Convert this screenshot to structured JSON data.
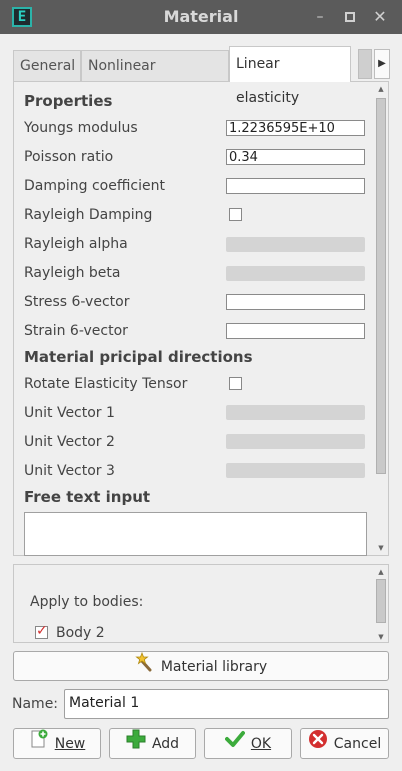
{
  "window": {
    "title": "Material",
    "app_icon_letter": "E",
    "minimize_glyph": "–",
    "maximize_glyph": "▫",
    "close_glyph": "✕"
  },
  "tabs": [
    {
      "label": "General",
      "active": false
    },
    {
      "label": "Nonlinear elasticity",
      "active": false
    },
    {
      "label": "Linear elasticity",
      "active": true
    }
  ],
  "properties": {
    "section_title": "Properties",
    "youngs_label": "Youngs modulus",
    "youngs_value": "1.2236595E+10",
    "poisson_label": "Poisson ratio",
    "poisson_value": "0.34",
    "damping_label": "Damping coefficient",
    "damping_value": "",
    "rayleigh_damping_label": "Rayleigh Damping",
    "rayleigh_damping_checked": false,
    "rayleigh_alpha_label": "Rayleigh alpha",
    "rayleigh_beta_label": "Rayleigh beta",
    "stress_label": "Stress 6-vector",
    "stress_value": "",
    "strain_label": "Strain 6-vector",
    "strain_value": ""
  },
  "directions": {
    "section_title": "Material pricipal directions",
    "rotate_label": "Rotate Elasticity Tensor",
    "rotate_checked": false,
    "unit1_label": "Unit Vector 1",
    "unit2_label": "Unit Vector 2",
    "unit3_label": "Unit Vector 3"
  },
  "free_text": {
    "section_title": "Free text input",
    "value": ""
  },
  "apply": {
    "label": "Apply to bodies:",
    "bodies": [
      {
        "name": "Body 2",
        "checked": true
      }
    ]
  },
  "buttons": {
    "material_library": "Material library",
    "new": "New",
    "add": "Add",
    "ok": "OK",
    "cancel": "Cancel"
  },
  "name_field": {
    "label": "Name:",
    "value": "Material 1"
  }
}
